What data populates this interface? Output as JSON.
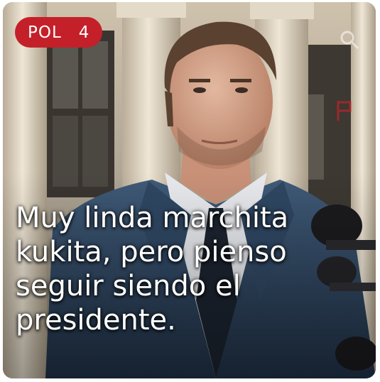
{
  "badge": {
    "section": "POL",
    "number": "4"
  },
  "caption": {
    "lines": [
      "Muy linda marchita",
      "kukita, pero pienso",
      "seguir siendo el",
      "presidente."
    ]
  },
  "icons": {
    "top_right": "search-icon",
    "side": "flag-icon"
  },
  "colors": {
    "badge_bg": "#c4202a",
    "caption_text": "#ffffff"
  }
}
